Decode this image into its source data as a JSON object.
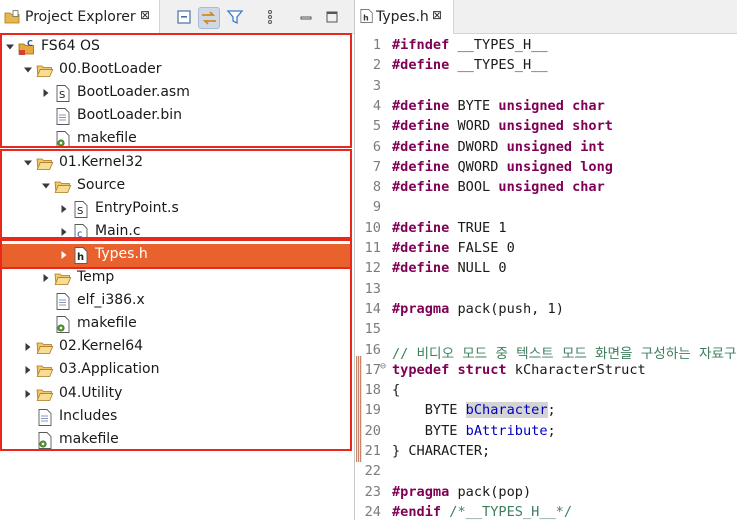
{
  "explorer": {
    "tab_title": "Project Explorer",
    "close_glyph": "⊠",
    "tree": [
      {
        "label": "FS64 OS",
        "icon": "c-project-icon",
        "twisty": "expanded",
        "depth": 0
      },
      {
        "label": "00.BootLoader",
        "icon": "folder-open-icon",
        "twisty": "expanded",
        "depth": 1
      },
      {
        "label": "BootLoader.asm",
        "icon": "asm-file-icon",
        "twisty": "collapsed",
        "depth": 2
      },
      {
        "label": "BootLoader.bin",
        "icon": "file-icon",
        "twisty": "none",
        "depth": 2
      },
      {
        "label": "makefile",
        "icon": "makefile-icon",
        "twisty": "none",
        "depth": 2
      },
      {
        "label": "01.Kernel32",
        "icon": "folder-open-icon",
        "twisty": "expanded",
        "depth": 1
      },
      {
        "label": "Source",
        "icon": "folder-open-icon",
        "twisty": "expanded",
        "depth": 2
      },
      {
        "label": "EntryPoint.s",
        "icon": "asm-file-icon",
        "twisty": "collapsed",
        "depth": 3
      },
      {
        "label": "Main.c",
        "icon": "c-file-icon",
        "twisty": "collapsed",
        "depth": 3
      },
      {
        "label": "Types.h",
        "icon": "h-file-icon",
        "twisty": "collapsed",
        "depth": 3,
        "selected": true
      },
      {
        "label": "Temp",
        "icon": "folder-open-icon",
        "twisty": "collapsed",
        "depth": 2
      },
      {
        "label": "elf_i386.x",
        "icon": "file-icon",
        "twisty": "none",
        "depth": 2
      },
      {
        "label": "makefile",
        "icon": "makefile-icon",
        "twisty": "none",
        "depth": 2
      },
      {
        "label": "02.Kernel64",
        "icon": "folder-open-icon",
        "twisty": "collapsed",
        "depth": 1
      },
      {
        "label": "03.Application",
        "icon": "folder-open-icon",
        "twisty": "collapsed",
        "depth": 1
      },
      {
        "label": "04.Utility",
        "icon": "folder-open-icon",
        "twisty": "collapsed",
        "depth": 1
      },
      {
        "label": "Includes",
        "icon": "file-icon",
        "twisty": "none",
        "depth": 1
      },
      {
        "label": "makefile",
        "icon": "makefile-icon",
        "twisty": "none",
        "depth": 1
      }
    ]
  },
  "editor": {
    "tab_title": "Types.h",
    "close_glyph": "⊠",
    "lines": [
      {
        "n": "1",
        "parts": [
          [
            "kw",
            "#ifndef"
          ],
          [
            "t",
            " __TYPES_H__"
          ]
        ]
      },
      {
        "n": "2",
        "parts": [
          [
            "kw",
            "#define"
          ],
          [
            "t",
            " __TYPES_H__"
          ]
        ]
      },
      {
        "n": "3",
        "parts": []
      },
      {
        "n": "4",
        "parts": [
          [
            "kw",
            "#define"
          ],
          [
            "t",
            " BYTE "
          ],
          [
            "kw",
            "unsigned char"
          ]
        ]
      },
      {
        "n": "5",
        "parts": [
          [
            "kw",
            "#define"
          ],
          [
            "t",
            " WORD "
          ],
          [
            "kw",
            "unsigned short"
          ]
        ]
      },
      {
        "n": "6",
        "parts": [
          [
            "kw",
            "#define"
          ],
          [
            "t",
            " DWORD "
          ],
          [
            "kw",
            "unsigned int"
          ]
        ]
      },
      {
        "n": "7",
        "parts": [
          [
            "kw",
            "#define"
          ],
          [
            "t",
            " QWORD "
          ],
          [
            "kw",
            "unsigned long"
          ]
        ]
      },
      {
        "n": "8",
        "parts": [
          [
            "kw",
            "#define"
          ],
          [
            "t",
            " BOOL "
          ],
          [
            "kw",
            "unsigned char"
          ]
        ]
      },
      {
        "n": "9",
        "parts": []
      },
      {
        "n": "10",
        "parts": [
          [
            "kw",
            "#define"
          ],
          [
            "t",
            " TRUE 1"
          ]
        ]
      },
      {
        "n": "11",
        "parts": [
          [
            "kw",
            "#define"
          ],
          [
            "t",
            " FALSE 0"
          ]
        ]
      },
      {
        "n": "12",
        "parts": [
          [
            "kw",
            "#define"
          ],
          [
            "t",
            " NULL 0"
          ]
        ]
      },
      {
        "n": "13",
        "parts": []
      },
      {
        "n": "14",
        "parts": [
          [
            "kw",
            "#pragma"
          ],
          [
            "t",
            " pack(push, 1)"
          ]
        ]
      },
      {
        "n": "15",
        "parts": []
      },
      {
        "n": "16",
        "parts": [
          [
            "cm",
            "// 비디오 모드 중 텍스트 모드 화면을 구성하는 자료구조"
          ]
        ]
      },
      {
        "n": "17",
        "fold": "⊖",
        "parts": [
          [
            "kw",
            "typedef struct"
          ],
          [
            "t",
            " kCharacterStruct"
          ]
        ]
      },
      {
        "n": "18",
        "parts": [
          [
            "t",
            "{"
          ]
        ]
      },
      {
        "n": "19",
        "parts": [
          [
            "t",
            "    BYTE "
          ],
          [
            "hl",
            "bCharacter"
          ],
          [
            "t",
            ";"
          ]
        ]
      },
      {
        "n": "20",
        "parts": [
          [
            "t",
            "    BYTE "
          ],
          [
            "fld",
            "bAttribute"
          ],
          [
            "t",
            ";"
          ]
        ]
      },
      {
        "n": "21",
        "parts": [
          [
            "t",
            "} CHARACTER;"
          ]
        ]
      },
      {
        "n": "22",
        "parts": []
      },
      {
        "n": "23",
        "parts": [
          [
            "kw",
            "#pragma"
          ],
          [
            "t",
            " pack(pop)"
          ]
        ]
      },
      {
        "n": "24",
        "parts": [
          [
            "kw",
            "#endif"
          ],
          [
            "cm",
            " /*__TYPES_H__*/"
          ]
        ]
      }
    ]
  }
}
